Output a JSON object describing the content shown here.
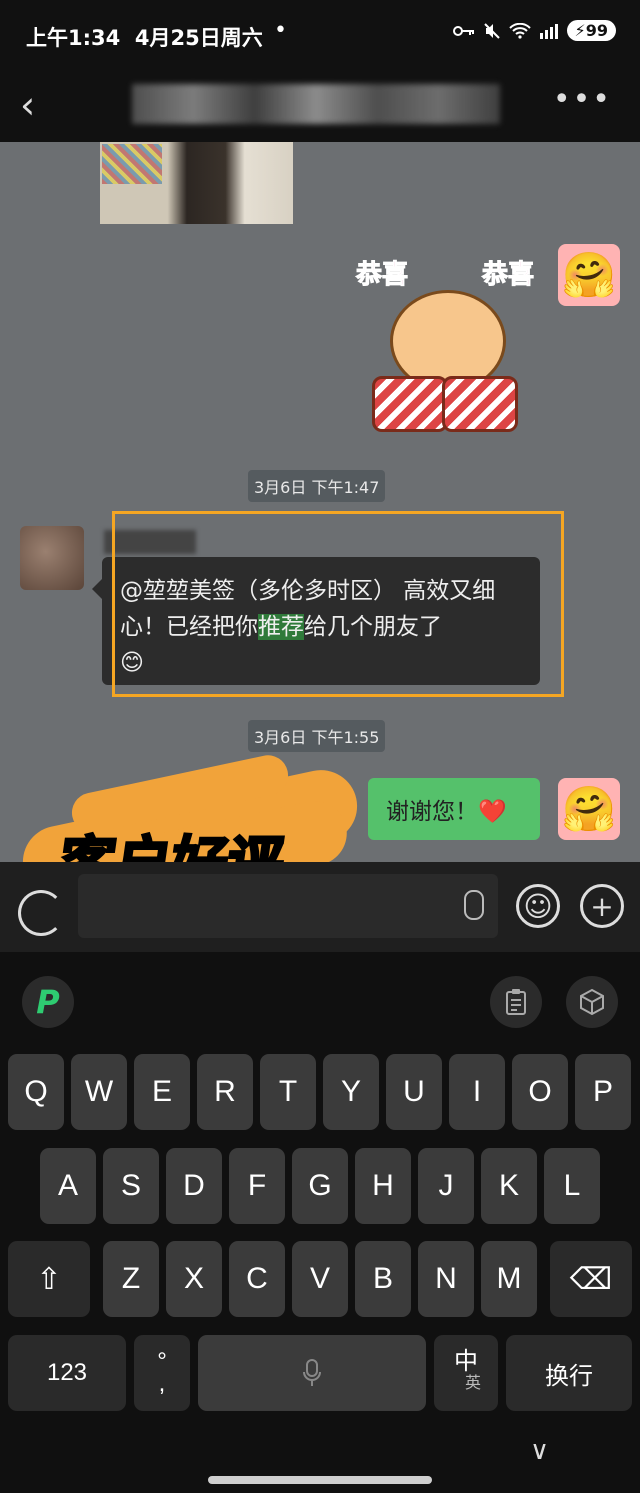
{
  "status_bar": {
    "time": "上午1:34",
    "date": "4月25日周六",
    "dot": "•",
    "battery": "99"
  },
  "nav": {
    "back_icon": "‹",
    "more_icon": "•••"
  },
  "chat": {
    "timestamps": [
      "3月6日 下午1:47",
      "3月6日 下午1:55"
    ],
    "sticker": {
      "left_text": "恭喜",
      "right_text": "恭喜"
    },
    "message_left": {
      "prefix": "@堃堃美签（多伦多时区） 高效又细心！已经把你",
      "highlight": "推荐",
      "suffix": "给几个朋友了",
      "emoji": "😊"
    },
    "message_right": {
      "text": "谢谢您！",
      "emoji": "❤️"
    },
    "overlay_caption": "客户好评"
  },
  "input_bar": {
    "emoji_icon": "☺",
    "plus_icon": "+"
  },
  "keyboard": {
    "row1": [
      "Q",
      "W",
      "E",
      "R",
      "T",
      "Y",
      "U",
      "I",
      "O",
      "P"
    ],
    "row2": [
      "A",
      "S",
      "D",
      "F",
      "G",
      "H",
      "J",
      "K",
      "L"
    ],
    "row3": [
      "Z",
      "X",
      "C",
      "V",
      "B",
      "N",
      "M"
    ],
    "shift": "⇧",
    "backspace": "⌫",
    "numbers_key": "123",
    "punct_top": "°",
    "punct_bottom": ",",
    "lang_top": "中",
    "lang_bottom": "英",
    "enter": "换行",
    "hide_icon": "∨",
    "toolbar_logo": "P"
  }
}
